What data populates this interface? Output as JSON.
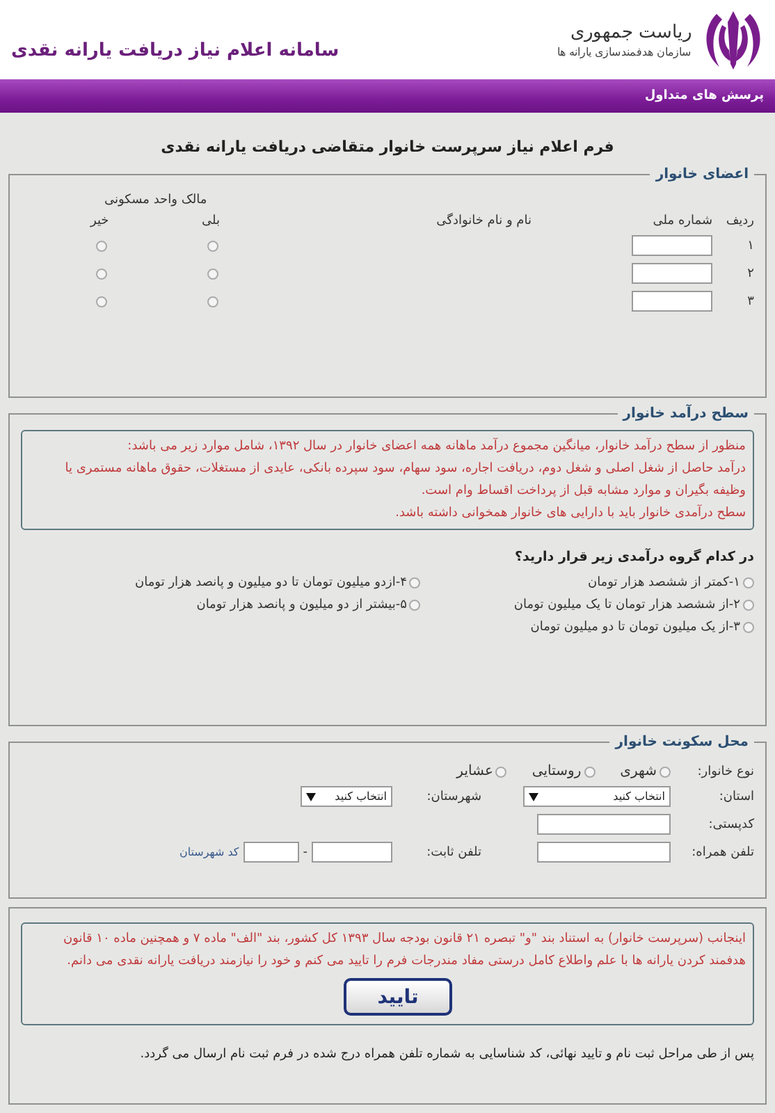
{
  "header": {
    "org_title": "ریاست جمهوری",
    "org_subtitle": "سازمان هدفمندسازی یارانه ها",
    "site_title": "سامانه اعلام نیاز دریافت یارانه نقدی"
  },
  "nav": {
    "items": [
      {
        "label": "پرسش های متداول"
      }
    ]
  },
  "form_title": "فرم اعلام نیاز سرپرست خانوار متقاضی دریافت یارانه نقدی",
  "members": {
    "legend": "اعضای خانوار",
    "col_row": "ردیف",
    "col_id": "شماره ملی",
    "col_name": "نام و نام خانوادگی",
    "col_owner": "مالک واحد مسکونی",
    "yes": "بلی",
    "no": "خیر",
    "rows": [
      {
        "index": "۱",
        "owner_yes": {
          "selected": false
        },
        "owner_no": {
          "selected": false
        }
      },
      {
        "index": "۲",
        "owner_yes": {
          "selected": false
        },
        "owner_no": {
          "selected": false
        }
      },
      {
        "index": "۳",
        "owner_yes": {
          "selected": false
        },
        "owner_no": {
          "selected": false
        }
      }
    ]
  },
  "income": {
    "legend": "سطح درآمد خانوار",
    "notice": [
      "منظور از سطح درآمد خانوار، میانگین مجموع درآمد ماهانه همه اعضای خانوار در سال ۱۳۹۲، شامل موارد زیر می باشد:",
      "درآمد حاصل از شغل اصلی و شغل دوم، دریافت اجاره، سود سهام، سود سپرده بانکی، عایدی از مستغلات، حقوق ماهانه مستمری یا وظیفه بگیران و موارد مشابه قبل از پرداخت اقساط وام است.",
      "سطح درآمدی خانوار باید با دارایی های خانوار همخوانی داشته باشد."
    ],
    "question": "در کدام گروه درآمدی زیر قرار دارید؟",
    "options": [
      {
        "label": "۱-کمتر از ششصد هزار تومان",
        "selected": false
      },
      {
        "label": "۲-از ششصد هزار تومان تا یک میلیون تومان",
        "selected": false
      },
      {
        "label": "۳-از یک میلیون تومان تا دو میلیون تومان",
        "selected": false
      },
      {
        "label": "۴-ازدو میلیون تومان تا دو میلیون و پانصد هزار تومان",
        "selected": false
      },
      {
        "label": "۵-بیشتر از دو میلیون و پانصد هزار تومان",
        "selected": false
      }
    ]
  },
  "residence": {
    "legend": "محل سکونت خانوار",
    "type_label": "نوع خانوار:",
    "types": [
      {
        "label": "شهری",
        "selected": false
      },
      {
        "label": "روستایی",
        "selected": false
      },
      {
        "label": "عشایر",
        "selected": false
      }
    ],
    "province_label": "استان:",
    "province_value": "انتخاب کنید",
    "city_label": "شهرستان:",
    "city_value": "انتخاب کنید",
    "postal_label": "کدپستی:",
    "mobile_label": "تلفن همراه:",
    "phone_label": "تلفن ثابت:",
    "dash": "-",
    "area_code_label": "کد شهرستان"
  },
  "confirm": {
    "statement": "اینجانب (سرپرست خانوار) به استناد بند \"و\" تبصره ۲۱ قانون بودجه سال ۱۳۹۳ کل کشور، بند \"الف\" ماده ۷ و همچنین ماده ۱۰ قانون هدفمند کردن یارانه ها با علم واطلاع کامل درستی مفاد مندرجات فرم را تایید می کنم و خود را نیازمند دریافت یارانه نقدی می دانم.",
    "button": "تایید",
    "footnote": "پس از طی مراحل ثبت نام و تایید نهائی، کد شناسایی به شماره تلفن همراه درج شده در فرم ثبت نام ارسال می گردد."
  }
}
